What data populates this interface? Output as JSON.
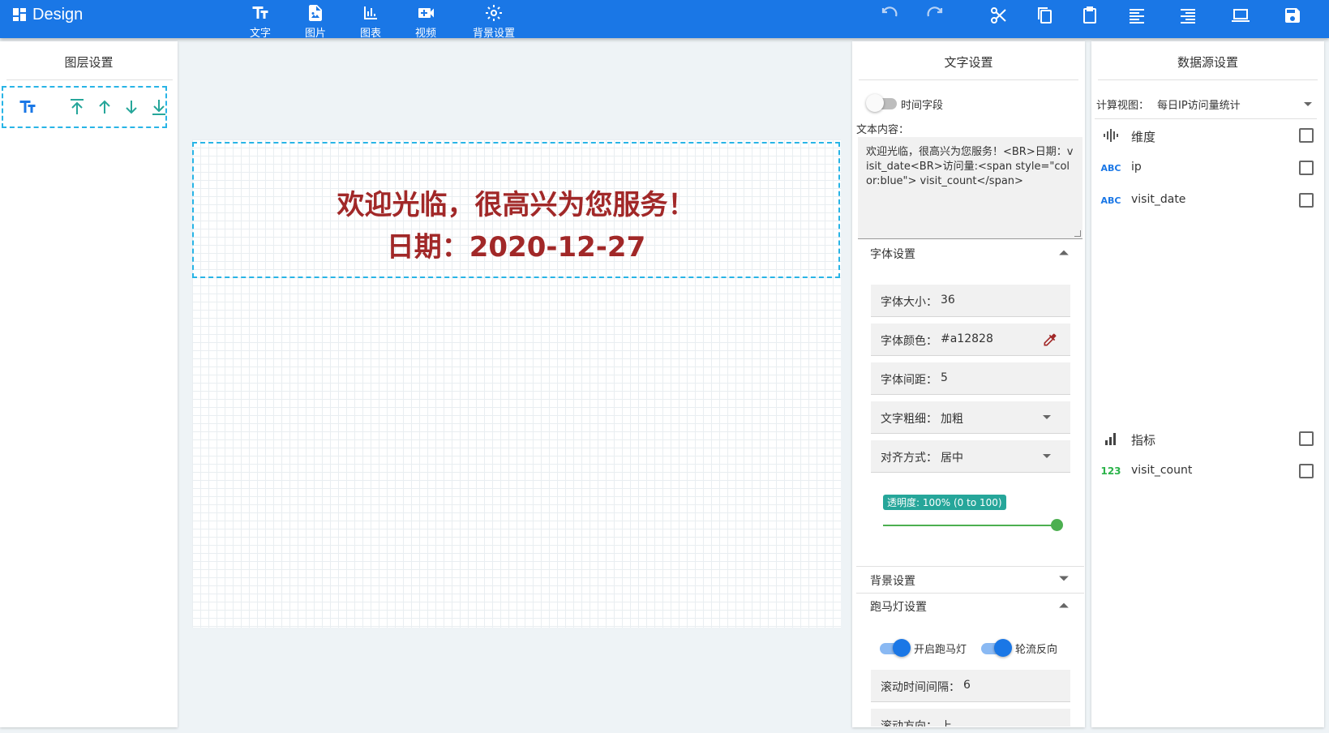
{
  "app": {
    "title": "Design"
  },
  "toolbar": {
    "insert": [
      {
        "label": "文字",
        "icon": "text-fields-icon"
      },
      {
        "label": "图片",
        "icon": "image-file-icon"
      },
      {
        "label": "图表",
        "icon": "bar-chart-icon"
      },
      {
        "label": "视频",
        "icon": "video-icon"
      },
      {
        "label": "背景设置",
        "icon": "gear-icon"
      }
    ],
    "actions": [
      "undo-icon",
      "redo-icon",
      "cut-icon",
      "copy-icon",
      "paste-icon",
      "align-icon",
      "align-alt-icon",
      "preview-icon",
      "save-icon"
    ]
  },
  "layer_panel": {
    "title": "图层设置"
  },
  "canvas": {
    "text_lines": [
      "欢迎光临，很高兴为您服务！",
      "日期：2020-12-27"
    ],
    "text_color": "#a12828"
  },
  "text_panel": {
    "title": "文字设置",
    "time_field_label": "时间字段",
    "content_label": "文本内容：",
    "content_value": "欢迎光临，很高兴为您服务！<BR>日期：visit_date<BR>访问量:<span style=\"color:blue\">   visit_count</span>",
    "font_section": "字体设置",
    "fields": [
      {
        "key": "字体大小：",
        "value": "36"
      },
      {
        "key": "字体颜色：",
        "value": "#a12828"
      },
      {
        "key": "字体间距：",
        "value": "5"
      },
      {
        "key": "文字粗细：",
        "value": "加粗"
      },
      {
        "key": "对齐方式：",
        "value": "居中"
      }
    ],
    "opacity_label": "透明度: 100% (0 to 100)",
    "opacity_value": 100,
    "bg_section": "背景设置",
    "marquee_section": "跑马灯设置",
    "marquee_on_label": "开启跑马灯",
    "marquee_reverse_label": "轮流反向",
    "interval_key": "滚动时间间隔：",
    "interval_value": "6",
    "direction_key": "滚动方向：",
    "direction_value": "上"
  },
  "ds_panel": {
    "title": "数据源设置",
    "view_label": "计算视图：",
    "view_value": "每日IP访问量统计",
    "dimension_label": "维度",
    "dimensions": [
      {
        "name": "ip",
        "type": "ABC"
      },
      {
        "name": "visit_date",
        "type": "ABC"
      }
    ],
    "measure_label": "指标",
    "measures": [
      {
        "name": "visit_count",
        "type": "123"
      }
    ]
  },
  "colors": {
    "primary": "#1a77e6",
    "accent_cyan": "#28b4e6",
    "text_red": "#a12828",
    "green": "#4caf50",
    "teal": "#26a69a"
  }
}
